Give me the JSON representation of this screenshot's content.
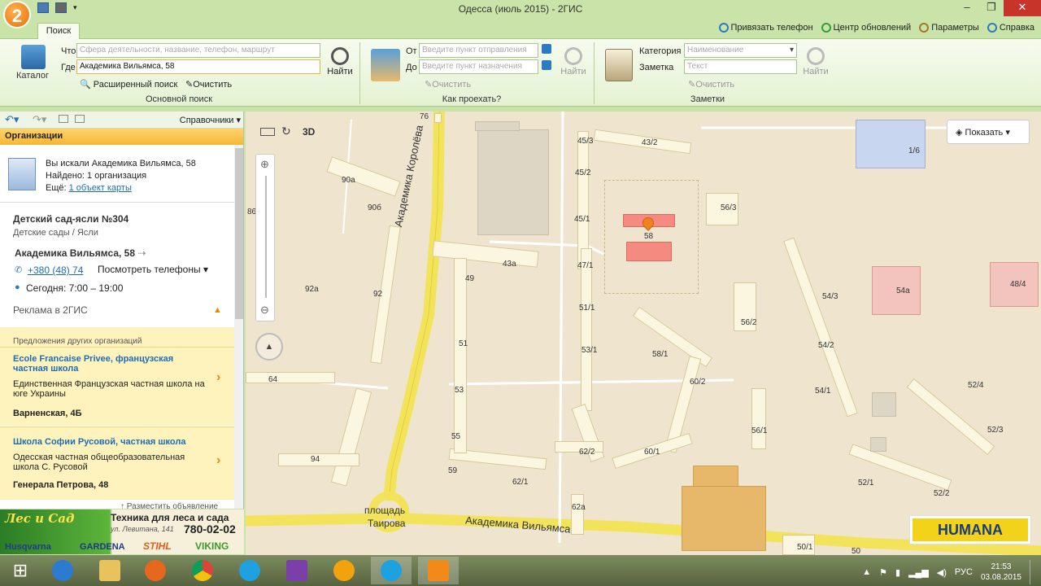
{
  "window": {
    "title": "Одесса (июль 2015) - 2ГИС",
    "logo": "2"
  },
  "ribbon": {
    "tab": "Поиск",
    "top_links": [
      "Привязать телефон",
      "Центр обновлений",
      "Параметры",
      "Справка"
    ],
    "main_search": {
      "catalog_label": "Каталог",
      "what_label": "Что",
      "what_placeholder": "Сфера деятельности, название, телефон, маршрут",
      "where_label": "Где",
      "where_value": "Академика Вильямса, 58",
      "find_label": "Найти",
      "advanced_label": "Расширенный поиск",
      "clear_label": "Очистить",
      "group_label": "Основной поиск"
    },
    "route": {
      "from_label": "От",
      "from_placeholder": "Введите пункт отправления",
      "to_label": "До",
      "to_placeholder": "Введите пункт назначения",
      "clear_label": "Очистить",
      "find_label": "Найти",
      "group_label": "Как проехать?"
    },
    "notes": {
      "category_label": "Категория",
      "category_placeholder": "Наименование",
      "note_label": "Заметка",
      "note_placeholder": "Текст",
      "clear_label": "Очистить",
      "find_label": "Найти",
      "group_label": "Заметки"
    }
  },
  "left_panel": {
    "directories_label": "Справочники",
    "section_header": "Организации",
    "search_summary": {
      "searched": "Вы искали Академика Вильямса, 58",
      "found": "Найдено: 1 организация",
      "more_prefix": "Ещё:",
      "more_link": "1 объект карты"
    },
    "org": {
      "name": "Детский сад-ясли №304",
      "category": "Детские сады / Ясли",
      "address": "Академика Вильямса, 58",
      "phone": "+380 (48) 74",
      "phones_button": "Посмотреть телефоны",
      "hours": "Сегодня: 7:00 – 19:00",
      "ad_label": "Реклама в 2ГИС"
    },
    "offers_header": "Предложения других организаций",
    "offers": [
      {
        "title": "Ecole Francaise Privee, французская частная школа",
        "desc": "Единственная Французская частная школа на юге Украины",
        "address": "Варненская, 4Б"
      },
      {
        "title": "Школа Софии Русовой, частная школа",
        "desc": "Одесская частная общеобразовательная школа С. Русовой",
        "address": "Генерала Петрова, 48"
      }
    ],
    "place_ad": "↑ Разместить объявление"
  },
  "banner": {
    "brand": "Лес и Сад",
    "tagline": "Техника для леса и сада",
    "street": "ул. Левитана, 141",
    "phone": "780-02-02",
    "brands": [
      "Husqvarna",
      "GARDENA",
      "STIHL",
      "VIKING"
    ]
  },
  "map": {
    "mode_3d": "3D",
    "show_button": "Показать",
    "ad": "HUMANA",
    "streets": [
      "Академика Королёва",
      "Академика Вильямса"
    ],
    "square": [
      "площадь",
      "Таирова"
    ],
    "labels": [
      "76",
      "45/3",
      "43/2",
      "45/2",
      "1/6",
      "56/3",
      "45/1",
      "58",
      "90а",
      "90б",
      "47/1",
      "43а",
      "49",
      "92а",
      "92",
      "51/1",
      "54/3",
      "56/2",
      "54а",
      "48/4",
      "58/1",
      "53/1",
      "54/2",
      "51",
      "60/2",
      "64",
      "54/1",
      "52/4",
      "53",
      "56/1",
      "55",
      "52/3",
      "94",
      "62/2",
      "60/1",
      "59",
      "62/1",
      "52/1",
      "52/2",
      "62а",
      "50/1",
      "50",
      "86"
    ]
  },
  "taskbar": {
    "lang": "РУС",
    "time": "21:53",
    "date": "03.08.2015"
  }
}
